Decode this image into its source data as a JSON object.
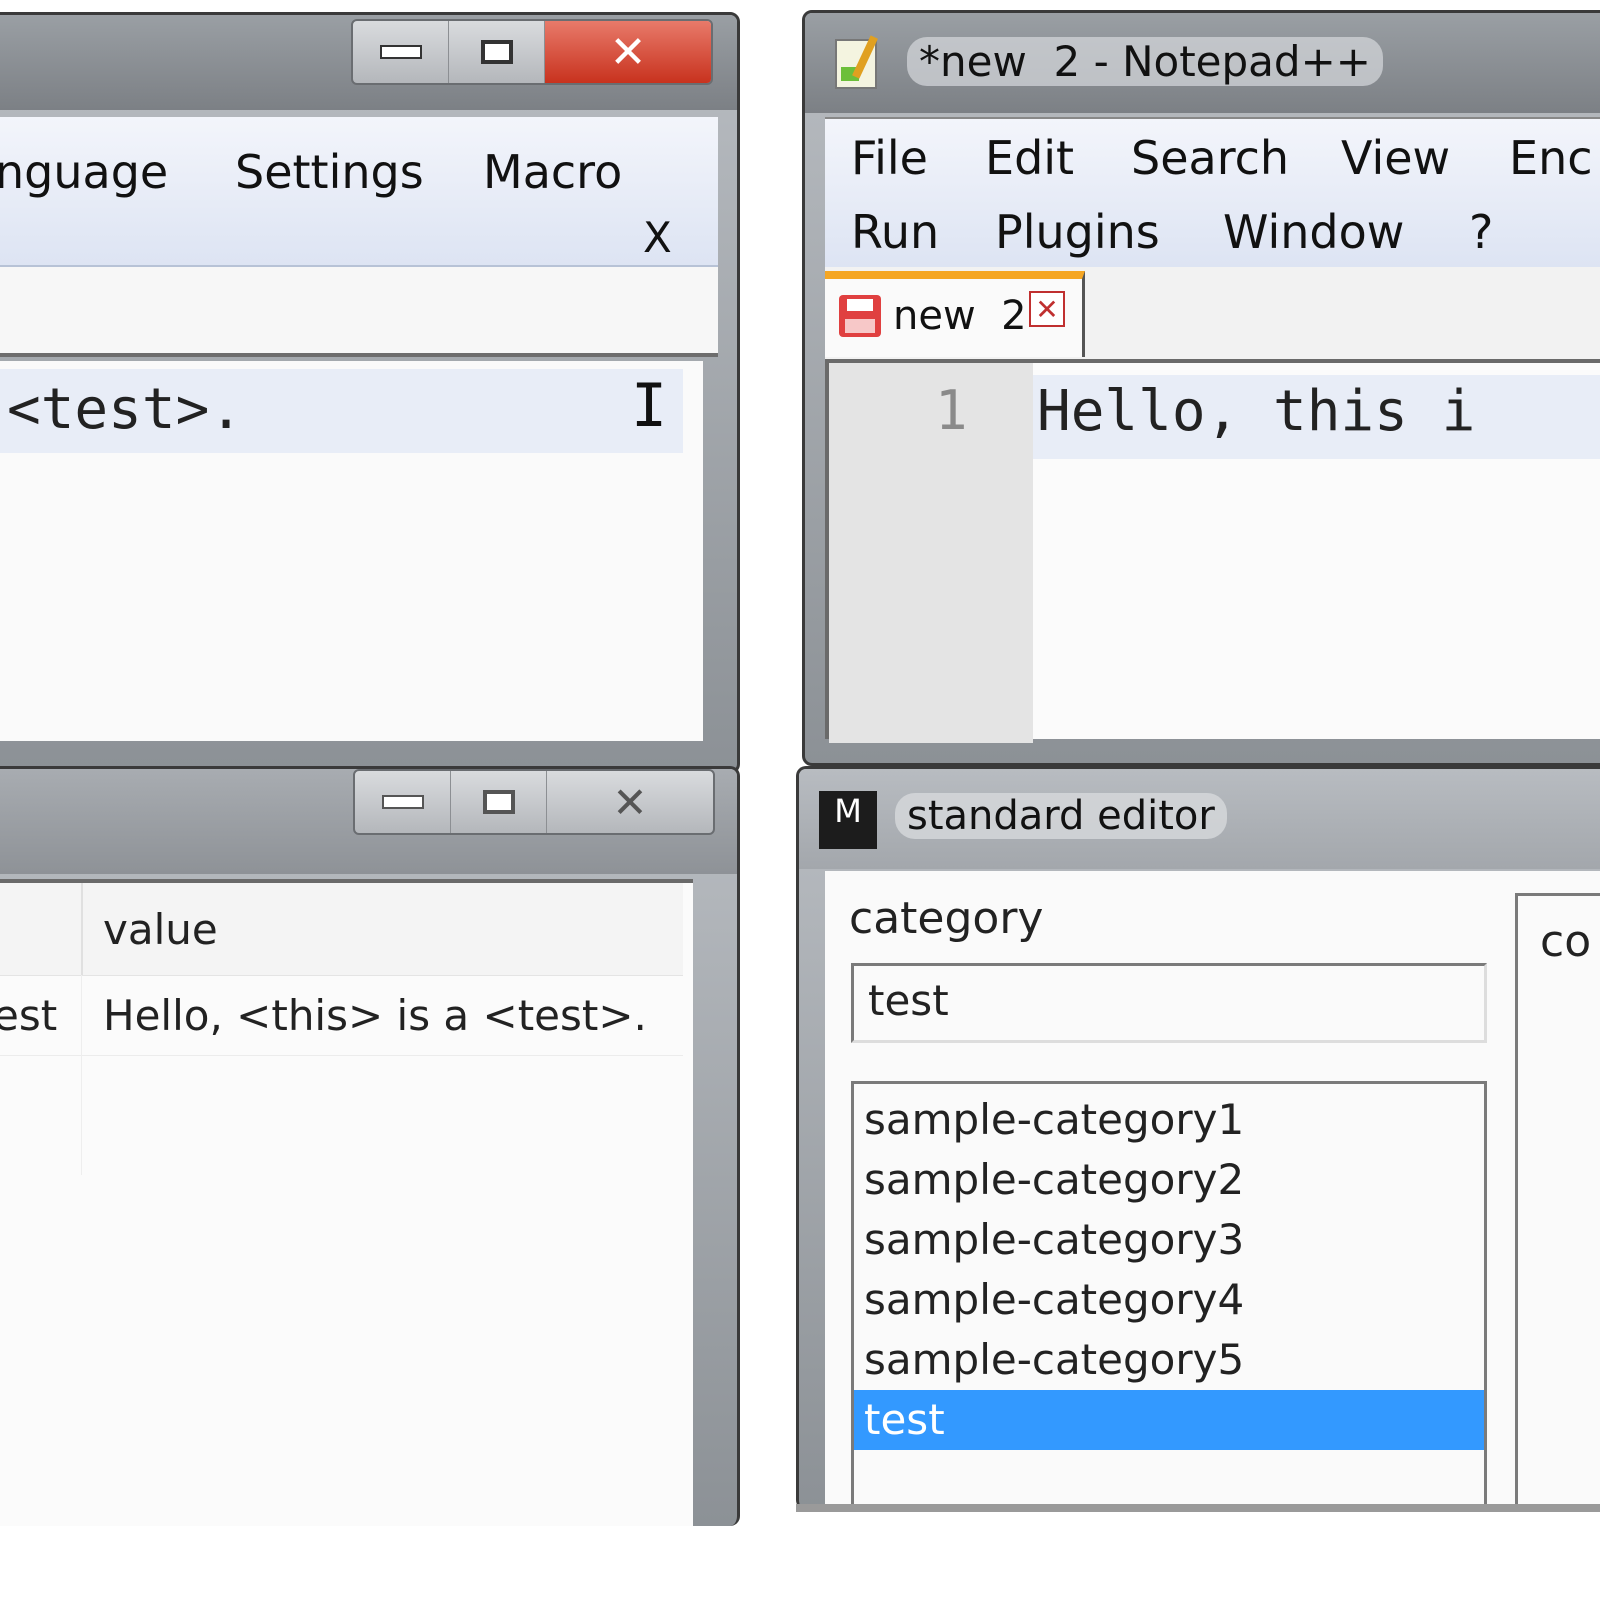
{
  "left_top_window": {
    "menu": [
      "nguage",
      "Settings",
      "Macro"
    ],
    "close_x": "X",
    "editor_text": "<test>."
  },
  "left_bottom_window": {
    "table": {
      "header": [
        "value"
      ],
      "rows": [
        {
          "key": "est",
          "value": "Hello, <this> is a <test>."
        }
      ]
    }
  },
  "notepad_window": {
    "title": "*new  2 - Notepad++",
    "menu_row1": [
      "File",
      "Edit",
      "Search",
      "View",
      "Enc"
    ],
    "menu_row2": [
      "Run",
      "Plugins",
      "Window",
      "?"
    ],
    "tab_label": "new  2",
    "line_number": "1",
    "line_text": "Hello, this i"
  },
  "standard_editor": {
    "app_icon_letter": "M",
    "title": "standard editor",
    "category_label": "category",
    "category_value": "test",
    "list_items": [
      "sample-category1",
      "sample-category2",
      "sample-category3",
      "sample-category4",
      "sample-category5",
      "test"
    ],
    "selected_index": 5,
    "right_panel_label": "co"
  },
  "colors": {
    "selection": "#3399ff",
    "tab_accent": "#f5a623",
    "close_red": "#c8321e"
  }
}
